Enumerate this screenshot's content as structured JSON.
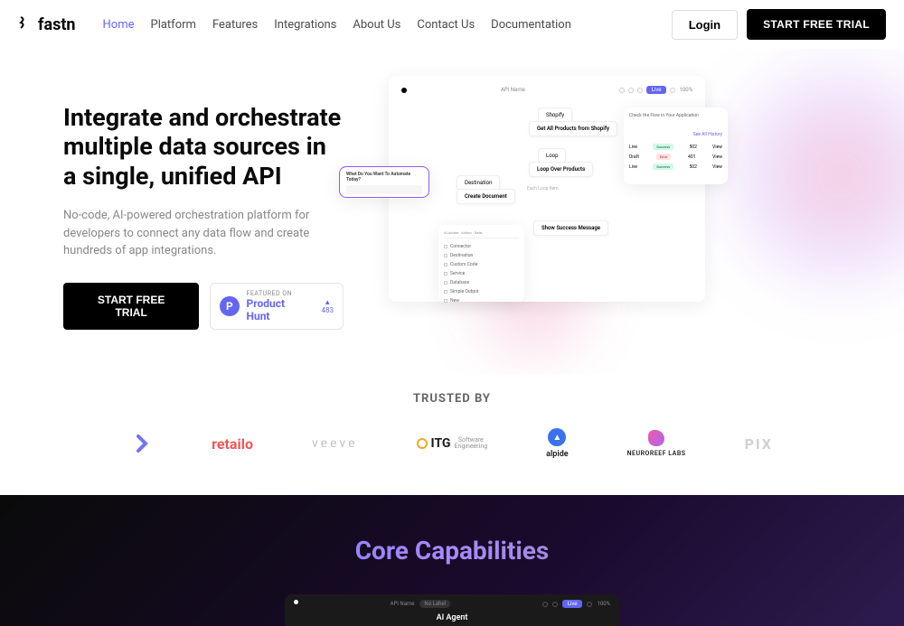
{
  "header": {
    "logo": "fastn",
    "nav": [
      "Home",
      "Platform",
      "Features",
      "Integrations",
      "About Us",
      "Contact Us",
      "Documentation"
    ],
    "login": "Login",
    "trial": "START FREE TRIAL"
  },
  "hero": {
    "title": "Integrate and orchestrate multiple data sources in a single, unified API",
    "subtitle": "No-code, AI-powered orchestration platform for developers to connect any data flow and create hundreds of app integrations.",
    "trial_btn": "START FREE TRIAL",
    "ph": {
      "featured": "FEATURED ON",
      "name": "Product Hunt",
      "votes": "483"
    }
  },
  "mockup": {
    "api_name_label": "API Name",
    "no_label": "No Label",
    "live": "Live",
    "zoom": "100%",
    "prompt_label": "What Do You Want To Automate Today?",
    "node_shopify": "Shopify",
    "node_get_products": "Get All Products from Shopify",
    "node_loop": "Loop",
    "node_loop_over": "Loop Over Products",
    "node_destination": "Destination",
    "node_create_doc": "Create Document",
    "node_each_loop": "Each Loop Item",
    "node_success": "Show Success Message",
    "config": {
      "tabs": [
        "AI Action",
        "Action",
        "Data"
      ],
      "items": [
        "Connector",
        "Destination",
        "Custom Code",
        "Service",
        "Database",
        "Simple Output",
        "New"
      ]
    },
    "history": {
      "title": "Check the Flow in Your Application",
      "link": "See All History",
      "rows": [
        {
          "status": "Live",
          "badge": "Success",
          "time": "502",
          "action": "View"
        },
        {
          "status": "Draft",
          "badge": "Error",
          "time": "401",
          "action": "View"
        },
        {
          "status": "Live",
          "badge": "Success",
          "time": "502",
          "action": "View"
        }
      ]
    }
  },
  "trusted": {
    "label": "TRUSTED BY",
    "logos": [
      "",
      "retailo",
      "veeve",
      "ITG",
      "alpide",
      "NEUROREEF LABS",
      "PIX"
    ]
  },
  "core": {
    "title": "Core Capabilities",
    "api_name": "API Name",
    "no_label": "No Label",
    "live": "Live",
    "zoom": "100%",
    "agent": "AI Agent"
  }
}
